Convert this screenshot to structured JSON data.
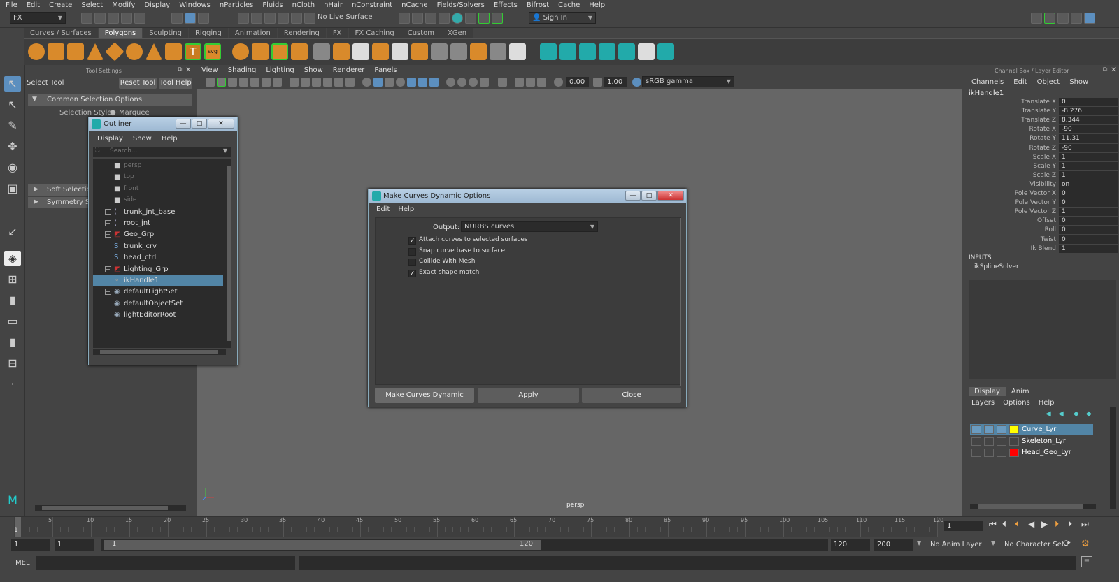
{
  "menubar": [
    "File",
    "Edit",
    "Create",
    "Select",
    "Modify",
    "Display",
    "Windows",
    "nParticles",
    "Fluids",
    "nCloth",
    "nHair",
    "nConstraint",
    "nCache",
    "Fields/Solvers",
    "Effects",
    "Bifrost",
    "Cache",
    "Help"
  ],
  "status": {
    "mode": "FX",
    "live_surface": "No Live Surface",
    "sign_in": "Sign In"
  },
  "shelf_tabs": [
    "Curves / Surfaces",
    "Polygons",
    "Sculpting",
    "Rigging",
    "Animation",
    "Rendering",
    "FX",
    "FX Caching",
    "Custom",
    "XGen"
  ],
  "shelf_active": "Polygons",
  "tool_settings": {
    "panel_title": "Tool Settings",
    "tool_name": "Select Tool",
    "reset_label": "Reset Tool",
    "help_label": "Tool Help",
    "section_common": "Common Selection Options",
    "selection_style_label": "Selection Style:",
    "selection_style_value": "Marquee",
    "section_soft": "Soft Selection",
    "section_symmetry": "Symmetry Settings"
  },
  "outliner": {
    "title": "Outliner",
    "menu": [
      "Display",
      "Show",
      "Help"
    ],
    "search_placeholder": "Search...",
    "items": [
      {
        "label": "persp",
        "icon": "camera-icon",
        "expand": false,
        "dim": true
      },
      {
        "label": "top",
        "icon": "camera-icon",
        "expand": false,
        "dim": true
      },
      {
        "label": "front",
        "icon": "camera-icon",
        "expand": false,
        "dim": true
      },
      {
        "label": "side",
        "icon": "camera-icon",
        "expand": false,
        "dim": true
      },
      {
        "label": "trunk_jnt_base",
        "icon": "joint-icon",
        "expand": true,
        "dim": false
      },
      {
        "label": "root_jnt",
        "icon": "joint-icon",
        "expand": true,
        "dim": false
      },
      {
        "label": "Geo_Grp",
        "icon": "group-icon",
        "expand": true,
        "dim": false
      },
      {
        "label": "trunk_crv",
        "icon": "curve-icon",
        "expand": false,
        "dim": false
      },
      {
        "label": "head_ctrl",
        "icon": "curve-icon",
        "expand": false,
        "dim": false
      },
      {
        "label": "Lighting_Grp",
        "icon": "group-icon",
        "expand": true,
        "dim": false
      },
      {
        "label": "ikHandle1",
        "icon": "ik-handle-icon",
        "expand": false,
        "dim": false,
        "selected": true
      },
      {
        "label": "defaultLightSet",
        "icon": "set-icon",
        "expand": true,
        "dim": false
      },
      {
        "label": "defaultObjectSet",
        "icon": "set-icon",
        "expand": false,
        "dim": false
      },
      {
        "label": "lightEditorRoot",
        "icon": "set-icon",
        "expand": false,
        "dim": false
      }
    ]
  },
  "viewport": {
    "menu": [
      "View",
      "Shading",
      "Lighting",
      "Show",
      "Renderer",
      "Panels"
    ],
    "exposure": "0.00",
    "gamma": "1.00",
    "color_space": "sRGB gamma",
    "camera_label": "persp"
  },
  "dialog": {
    "title": "Make Curves Dynamic Options",
    "menu": [
      "Edit",
      "Help"
    ],
    "output_label": "Output:",
    "output_value": "NURBS curves",
    "options": [
      {
        "label": "Attach curves to selected surfaces",
        "checked": true
      },
      {
        "label": "Snap curve base to surface",
        "checked": false
      },
      {
        "label": "Collide With Mesh",
        "checked": false
      },
      {
        "label": "Exact shape match",
        "checked": true
      }
    ],
    "buttons": {
      "primary": "Make Curves Dynamic",
      "apply": "Apply",
      "close": "Close"
    }
  },
  "channel_box": {
    "panel_title": "Channel Box / Layer Editor",
    "menu": [
      "Channels",
      "Edit",
      "Object",
      "Show"
    ],
    "node": "ikHandle1",
    "attributes": [
      {
        "name": "Translate X",
        "value": "0"
      },
      {
        "name": "Translate Y",
        "value": "-8.276"
      },
      {
        "name": "Translate Z",
        "value": "8.344"
      },
      {
        "name": "Rotate X",
        "value": "-90"
      },
      {
        "name": "Rotate Y",
        "value": "11.31"
      },
      {
        "name": "Rotate Z",
        "value": "-90"
      },
      {
        "name": "Scale X",
        "value": "1"
      },
      {
        "name": "Scale Y",
        "value": "1"
      },
      {
        "name": "Scale Z",
        "value": "1"
      },
      {
        "name": "Visibility",
        "value": "on"
      },
      {
        "name": "Pole Vector X",
        "value": "0"
      },
      {
        "name": "Pole Vector Y",
        "value": "0"
      },
      {
        "name": "Pole Vector Z",
        "value": "1"
      },
      {
        "name": "Offset",
        "value": "0"
      },
      {
        "name": "Roll",
        "value": "0"
      },
      {
        "name": "Twist",
        "value": "0"
      },
      {
        "name": "Ik Blend",
        "value": "1"
      }
    ],
    "inputs_label": "INPUTS",
    "inputs_node": "ikSplineSolver"
  },
  "layer_editor": {
    "tabs": [
      "Display",
      "Anim"
    ],
    "active_tab": "Display",
    "menu": [
      "Layers",
      "Options",
      "Help"
    ],
    "layers": [
      {
        "name": "Curve_Lyr",
        "color": "#ffff00",
        "selected": true
      },
      {
        "name": "Skeleton_Lyr",
        "color": "#444444",
        "selected": false
      },
      {
        "name": "Head_Geo_Lyr",
        "color": "#ff0000",
        "selected": false
      }
    ]
  },
  "timeline": {
    "ticks": [
      "5",
      "10",
      "15",
      "20",
      "25",
      "30",
      "35",
      "40",
      "45",
      "50",
      "55",
      "60",
      "65",
      "70",
      "75",
      "80",
      "85",
      "90",
      "95",
      "100",
      "105",
      "110",
      "115",
      "120"
    ],
    "start_marker": "1",
    "current_frame": "1"
  },
  "range": {
    "start": "1",
    "playback_start": "1",
    "slider_start": "1",
    "slider_end": "120",
    "playback_end": "120",
    "end": "200",
    "anim_layer": "No Anim Layer",
    "char_set": "No Character Set"
  },
  "cmdline": {
    "label": "MEL"
  }
}
